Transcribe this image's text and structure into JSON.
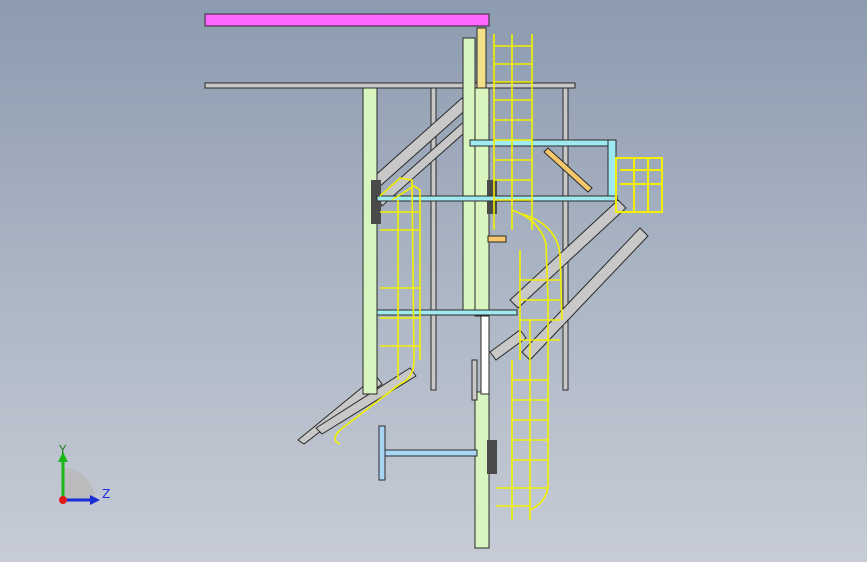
{
  "triad": {
    "y_label": "Y",
    "z_label": "Z",
    "colors": {
      "y": "#18b818",
      "z": "#1a2ed8",
      "x": "#e01818"
    }
  },
  "colors": {
    "magenta_beam": "#ff66ff",
    "light_green_member": "#d8f5c0",
    "cyan_member": "#9fe9f0",
    "yellow_railing": "#f2f000",
    "gray_structure": "#c8c8c8",
    "outline": "#2a2a2a",
    "orange_brace": "#f5c76a",
    "light_blue_member": "#a9d5f5"
  }
}
